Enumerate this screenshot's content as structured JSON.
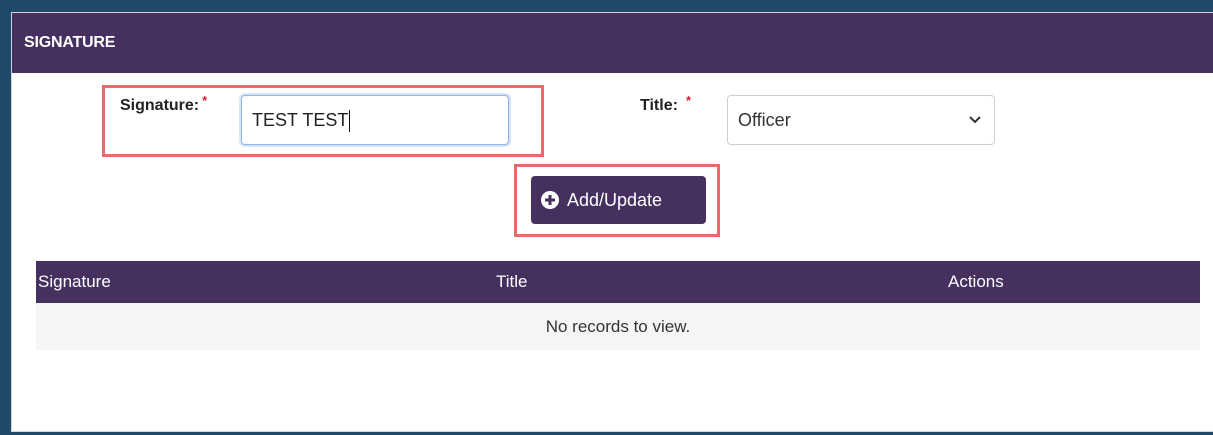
{
  "panel": {
    "title": "SIGNATURE"
  },
  "form": {
    "signature_label": "Signature:",
    "signature_required": "*",
    "signature_value": "TEST TEST",
    "title_label": "Title:",
    "title_required": "*",
    "title_selected": "Officer",
    "add_button_label": "Add/Update"
  },
  "table": {
    "columns": [
      "Signature",
      "Title",
      "Actions"
    ],
    "empty_message": "No records to view."
  },
  "colors": {
    "header_bg": "#45305f",
    "highlight_border": "#e26b6b",
    "required_star": "#d0203a",
    "input_focus_border": "#8fb6e4"
  },
  "icons": {
    "add_button_icon": "plus-circle-icon",
    "select_icon": "chevron-down-icon"
  }
}
